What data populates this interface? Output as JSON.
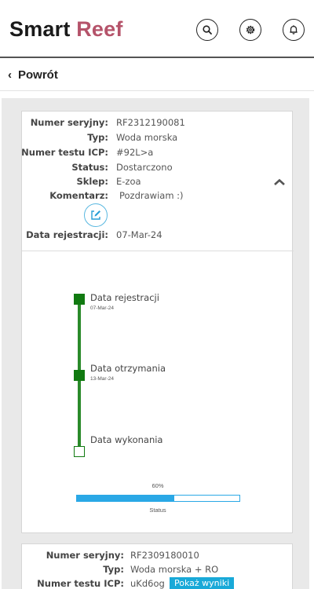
{
  "header": {
    "brand_part1": "Smart",
    "brand_part2": "Reef",
    "icons": [
      "search-icon",
      "gear-icon",
      "bell-icon"
    ]
  },
  "nav": {
    "back_label": "Powrót"
  },
  "cards": [
    {
      "serial_label": "Numer seryjny:",
      "serial_value": "RF2312190081",
      "type_label": "Typ:",
      "type_value": "Woda morska",
      "icp_label": "Numer testu ICP:",
      "icp_value": "#92L>a",
      "status_label": "Status:",
      "status_value": "Dostarczono",
      "shop_label": "Sklep:",
      "shop_value": "E-zoa",
      "comment_label": "Komentarz:",
      "comment_value": "Pozdrawiam :)",
      "reg_label": "Data rejestracji:",
      "reg_value": "07-Mar-24",
      "timeline": [
        {
          "label": "Data rejestracji",
          "date": "07-Mar-24",
          "done": true
        },
        {
          "label": "Data otrzymania",
          "date": "13-Mar-24",
          "done": true
        },
        {
          "label": "Data wykonania",
          "date": "",
          "done": false
        }
      ],
      "progress_text": "60%",
      "progress_value": 0.6,
      "progress_caption": "Status"
    },
    {
      "serial_label": "Numer seryjny:",
      "serial_value": "RF2309180010",
      "type_label": "Typ:",
      "type_value": "Woda morska + RO",
      "icp_label": "Numer testu ICP:",
      "icp_value": "uKd6og",
      "results_button": "Pokaż wyniki"
    }
  ],
  "colors": {
    "brand_accent": "#b5536a",
    "timeline_green": "#117a11",
    "progress_blue": "#2aa8e6",
    "button_blue": "#19a9d8"
  }
}
